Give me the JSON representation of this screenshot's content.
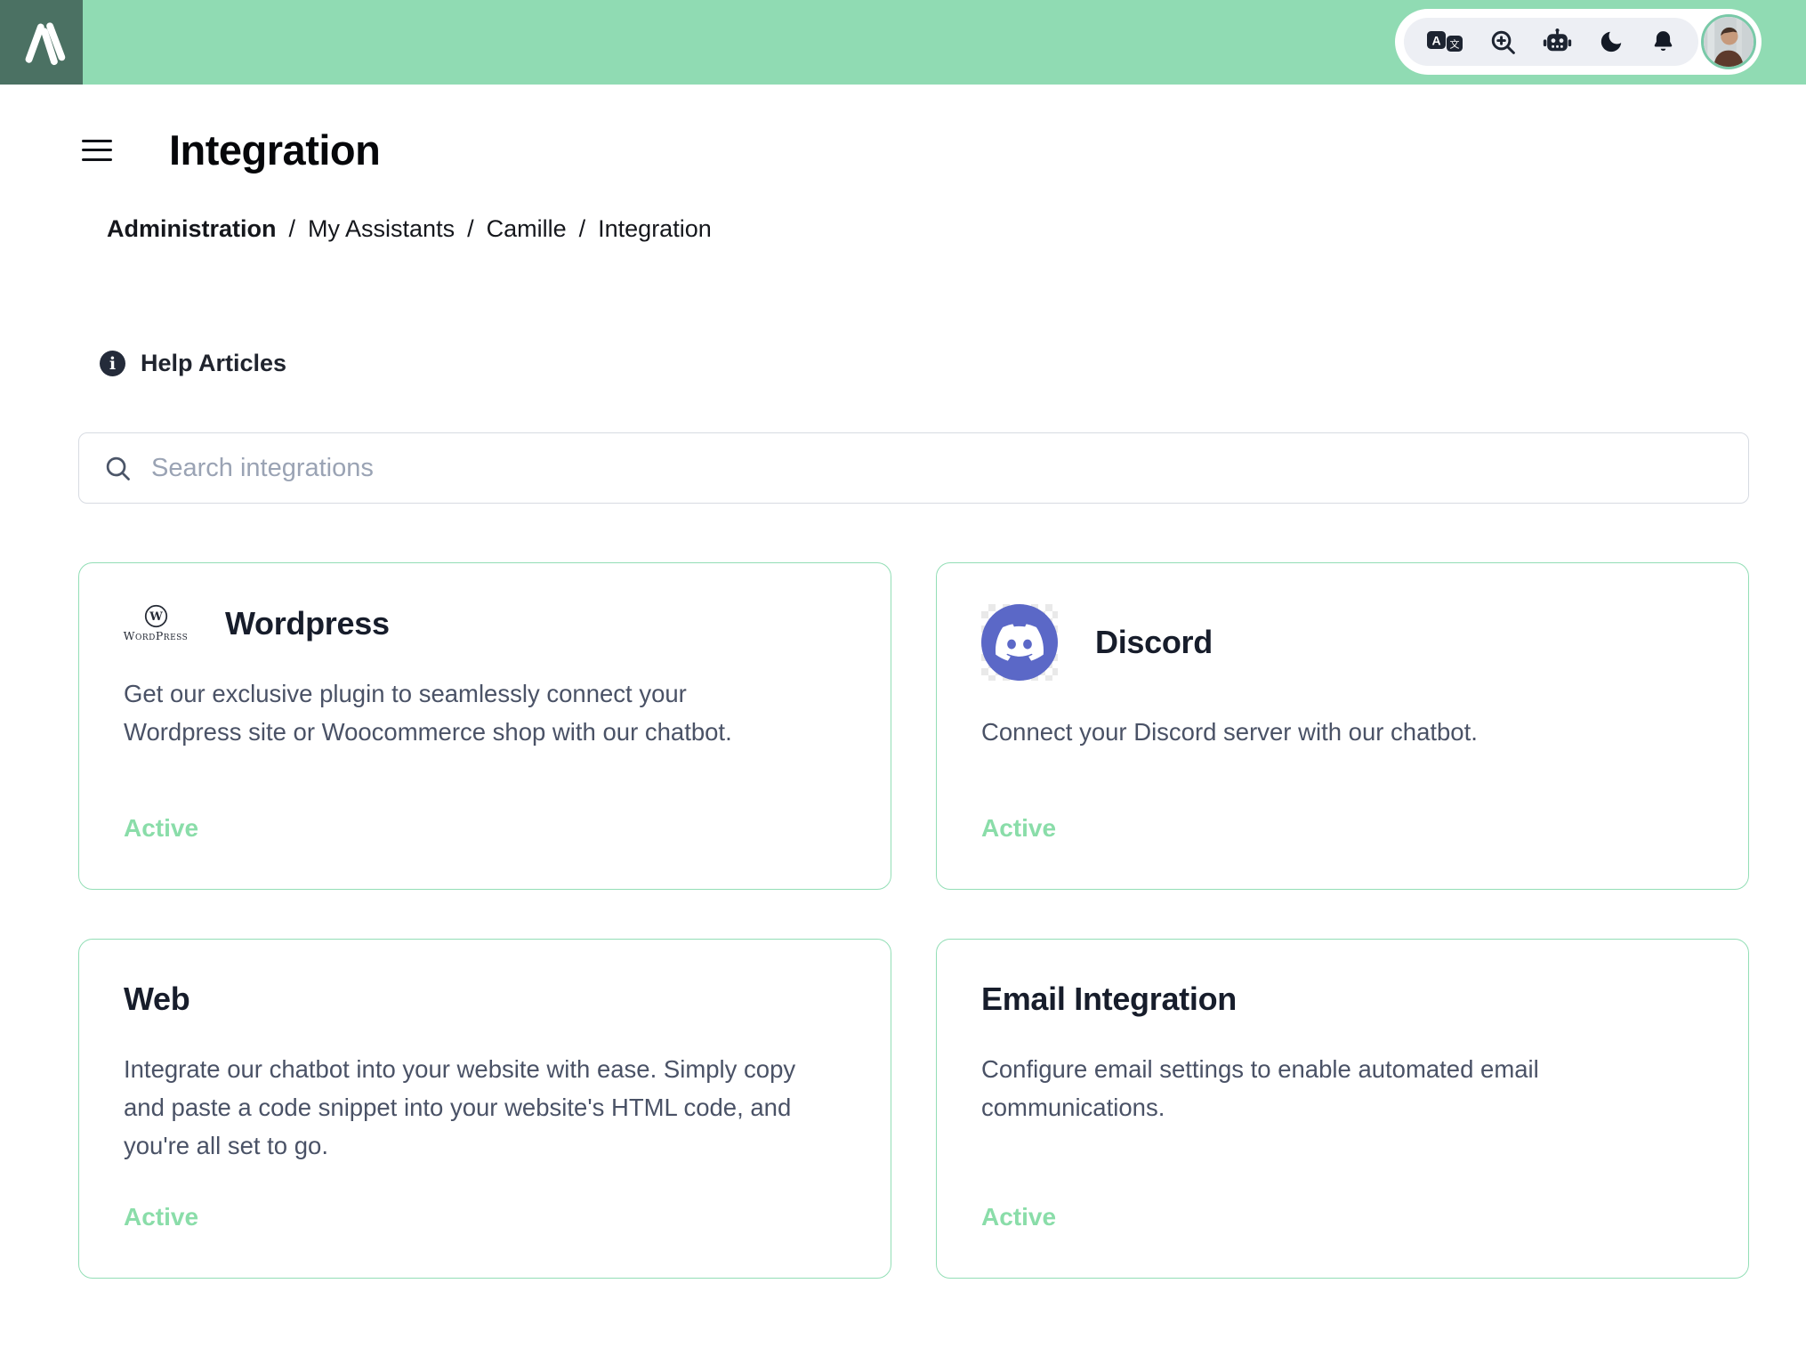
{
  "header": {
    "brand_logo": "brand-mark",
    "toolbar": {
      "translate_left_glyph": "A",
      "translate_right_glyph": "文",
      "icons": [
        "translate",
        "zoom-in",
        "agent-robot",
        "dark-mode-moon",
        "notifications-bell"
      ],
      "avatar": "user-profile-photo"
    }
  },
  "page": {
    "title": "Integration",
    "breadcrumb": {
      "separator": "/",
      "items": [
        "Administration",
        "My Assistants",
        "Camille",
        "Integration"
      ]
    },
    "help_label": "Help Articles",
    "search": {
      "placeholder": "Search integrations"
    }
  },
  "cards": [
    {
      "title": "Wordpress",
      "logo_text": "WordPress",
      "logo_letter": "W",
      "description": "Get our exclusive plugin to seamlessly connect your Wordpress site or Woocommerce shop with our chatbot.",
      "status": "Active"
    },
    {
      "title": "Discord",
      "description": "Connect your Discord server with our chatbot.",
      "status": "Active"
    },
    {
      "title": "Web",
      "description": "Integrate our chatbot into your website with ease. Simply copy and paste a code snippet into your website's HTML code, and you're all set to go.",
      "status": "Active"
    },
    {
      "title": "Email Integration",
      "description": "Configure email settings to enable automated email communications.",
      "status": "Active"
    }
  ],
  "colors": {
    "header_green": "#90dbb3",
    "brand_square": "#4b7163",
    "card_border": "#93deb6",
    "status_active": "#8adda9",
    "discord_blurple": "#5b68c7",
    "text_dark": "#171d2b",
    "text_muted": "#4a5266"
  }
}
